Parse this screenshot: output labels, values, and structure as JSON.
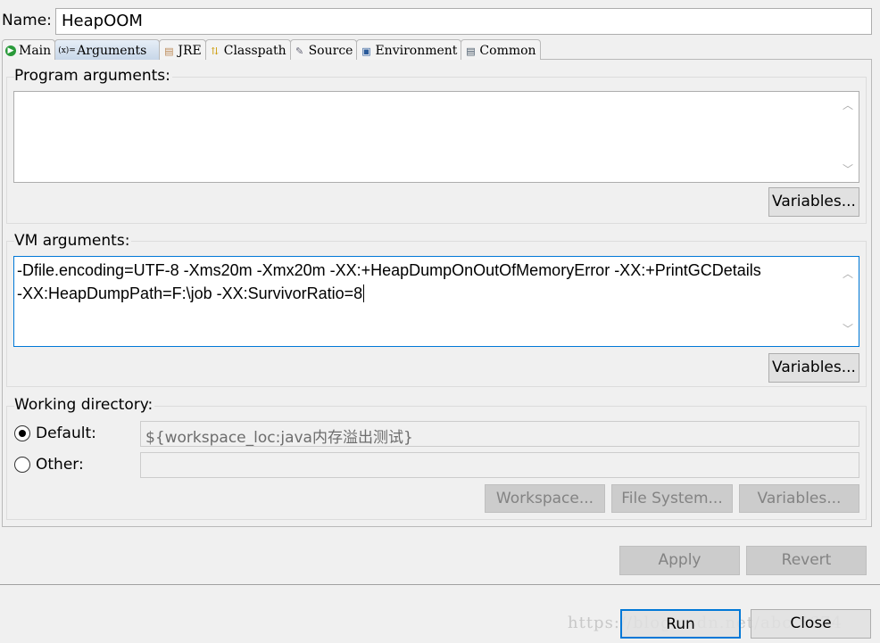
{
  "name_label": "Name:",
  "name_value": "HeapOOM",
  "tabs": [
    {
      "label": "Main",
      "icon": "main-icon"
    },
    {
      "label": "Arguments",
      "icon": "arguments-icon"
    },
    {
      "label": "JRE",
      "icon": "jre-icon"
    },
    {
      "label": "Classpath",
      "icon": "classpath-icon"
    },
    {
      "label": "Source",
      "icon": "source-icon"
    },
    {
      "label": "Environment",
      "icon": "environment-icon"
    },
    {
      "label": "Common",
      "icon": "common-icon"
    }
  ],
  "active_tab": "Arguments",
  "program_args": {
    "label": "Program arguments:",
    "value": "",
    "variables": "Variables..."
  },
  "vm_args": {
    "label": "VM arguments:",
    "line1": "-Dfile.encoding=UTF-8 -Xms20m -Xmx20m -XX:+HeapDumpOnOutOfMemoryError -XX:+PrintGCDetails",
    "line2": "-XX:HeapDumpPath=F:\\job -XX:SurvivorRatio=8",
    "variables": "Variables..."
  },
  "working_dir": {
    "label": "Working directory:",
    "default_label": "Default:",
    "default_value": "${workspace_loc:java内存溢出测试}",
    "other_label": "Other:",
    "other_value": "",
    "selected": "Default",
    "workspace": "Workspace...",
    "file_system": "File System...",
    "variables": "Variables..."
  },
  "apply": "Apply",
  "revert": "Revert",
  "run": "Run",
  "close": "Close",
  "watermark": "https://blog.csdn.net/abc      5674"
}
